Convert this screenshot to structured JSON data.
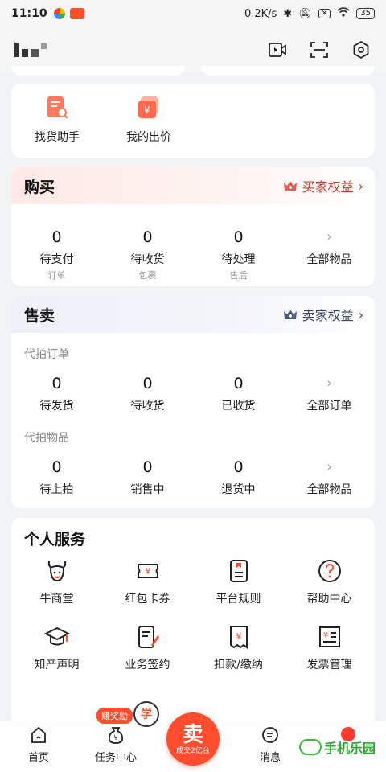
{
  "status_bar": {
    "time": "11:10",
    "speed": "0.2K/s",
    "battery": "35"
  },
  "colors": {
    "accent": "#ff4d2d",
    "buyer_crown": "#e85a4f",
    "seller_crown": "#4a5a7a"
  },
  "quick_links": [
    {
      "label": "找货助手",
      "icon": "find-goods-icon"
    },
    {
      "label": "我的出价",
      "icon": "my-bid-icon"
    }
  ],
  "buy": {
    "title": "购买",
    "rights": "买家权益",
    "items": [
      {
        "num": "0",
        "label": "待支付",
        "sub": "订单"
      },
      {
        "num": "0",
        "label": "待收货",
        "sub": "包裹"
      },
      {
        "num": "0",
        "label": "待处理",
        "sub": "售后"
      },
      {
        "label": "全部物品"
      }
    ]
  },
  "sell": {
    "title": "售卖",
    "rights": "卖家权益",
    "order_section": "代拍订单",
    "orders": [
      {
        "num": "0",
        "label": "待发货"
      },
      {
        "num": "0",
        "label": "待收货"
      },
      {
        "num": "0",
        "label": "已收货"
      },
      {
        "label": "全部订单"
      }
    ],
    "goods_section": "代拍物品",
    "goods": [
      {
        "num": "0",
        "label": "待上拍"
      },
      {
        "num": "0",
        "label": "销售中"
      },
      {
        "num": "0",
        "label": "退货中"
      },
      {
        "label": "全部物品"
      }
    ]
  },
  "services": {
    "title": "个人服务",
    "items": [
      {
        "label": "牛商堂",
        "icon": "cow-icon"
      },
      {
        "label": "红包卡券",
        "icon": "coupon-icon"
      },
      {
        "label": "平台规则",
        "icon": "rules-icon"
      },
      {
        "label": "帮助中心",
        "icon": "help-icon"
      },
      {
        "label": "知产声明",
        "icon": "graduation-cap-icon"
      },
      {
        "label": "业务签约",
        "icon": "contract-icon"
      },
      {
        "label": "扣款/缴纳",
        "icon": "payment-icon"
      },
      {
        "label": "发票管理",
        "icon": "invoice-icon"
      }
    ]
  },
  "tabbar": {
    "home": "首页",
    "tasks": "任务中心",
    "sell_big": "卖",
    "sell_small": "成交2亿台",
    "messages": "消息",
    "reward_badge": "赚奖励",
    "learn": "学"
  },
  "watermark": "手机乐园"
}
